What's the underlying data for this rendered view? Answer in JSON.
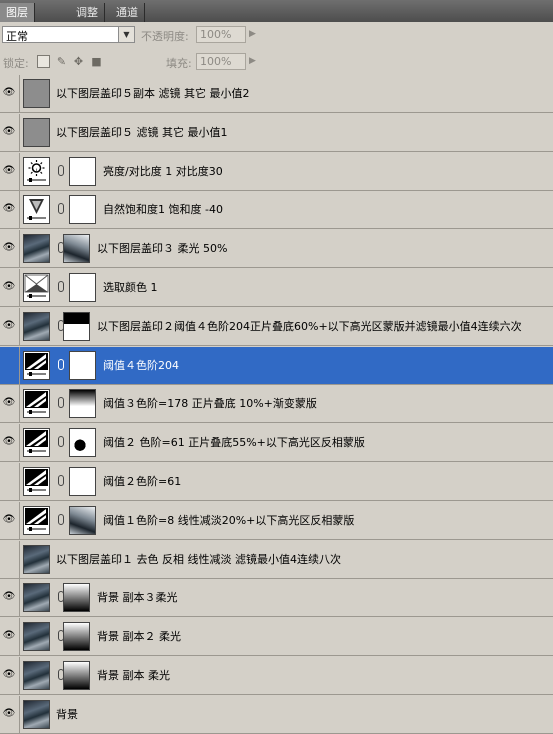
{
  "tabs": [
    {
      "label": "图层",
      "active": true
    },
    {
      "label": "调整",
      "active": false
    },
    {
      "label": "通道",
      "active": false
    }
  ],
  "blend": {
    "mode": "正常",
    "opacity_label": "不透明度:",
    "opacity_value": "100%"
  },
  "lock": {
    "label": "锁定:",
    "fill_label": "填充:",
    "fill_value": "100%"
  },
  "layers": [
    {
      "name": "以下图层盖印５副本  滤镜  其它  最小值2",
      "visible": true,
      "selected": false,
      "thumb": "gray",
      "mask": null
    },
    {
      "name": "以下图层盖印５ 滤镜  其它  最小值1",
      "visible": true,
      "selected": false,
      "thumb": "gray",
      "mask": null
    },
    {
      "name": "亮度/对比度 1   对比度30",
      "visible": true,
      "selected": false,
      "thumb": "brightness",
      "mask": "white"
    },
    {
      "name": "自然饱和度1    饱和度 -40",
      "visible": true,
      "selected": false,
      "thumb": "vibrance",
      "mask": "white"
    },
    {
      "name": "以下图层盖印３    柔光 50%",
      "visible": true,
      "selected": false,
      "thumb": "photo",
      "mask": "photo2"
    },
    {
      "name": "选取颜色 1",
      "visible": true,
      "selected": false,
      "thumb": "selective",
      "mask": "white"
    },
    {
      "name": "以下图层盖印２阈值４色阶204正片叠底60%+以下高光区蒙版并滤镜最小值4连续六次",
      "visible": true,
      "selected": false,
      "thumb": "photo",
      "mask": "blackmask"
    },
    {
      "name": "阈值４色阶204",
      "visible": false,
      "selected": true,
      "thumb": "threshold",
      "mask": "white"
    },
    {
      "name": "阈值３色阶=178   正片叠底 10%+渐变蒙版",
      "visible": true,
      "selected": false,
      "thumb": "threshold",
      "mask": "gradmask2"
    },
    {
      "name": "阈值２ 色阶=61   正片叠底55%+以下高光区反相蒙版",
      "visible": true,
      "selected": false,
      "thumb": "threshold",
      "mask": "splatter"
    },
    {
      "name": "阈值２色阶=61",
      "visible": false,
      "selected": false,
      "thumb": "threshold",
      "mask": "white"
    },
    {
      "name": "阈值１色阶=8  线性减淡20%+以下高光区反相蒙版",
      "visible": true,
      "selected": false,
      "thumb": "threshold",
      "mask": "photo2"
    },
    {
      "name": "以下图层盖印１  去色  反相  线性减淡   滤镜最小值4连续八次",
      "visible": false,
      "selected": false,
      "thumb": "photo",
      "mask": null
    },
    {
      "name": "背景 副本３柔光",
      "visible": true,
      "selected": false,
      "thumb": "photo",
      "mask": "gradmask"
    },
    {
      "name": "背景 副本２ 柔光",
      "visible": true,
      "selected": false,
      "thumb": "photo",
      "mask": "gradmask"
    },
    {
      "name": "背景 副本 柔光",
      "visible": true,
      "selected": false,
      "thumb": "photo",
      "mask": "gradmask"
    },
    {
      "name": "背景",
      "visible": true,
      "selected": false,
      "thumb": "photo",
      "mask": null
    }
  ]
}
